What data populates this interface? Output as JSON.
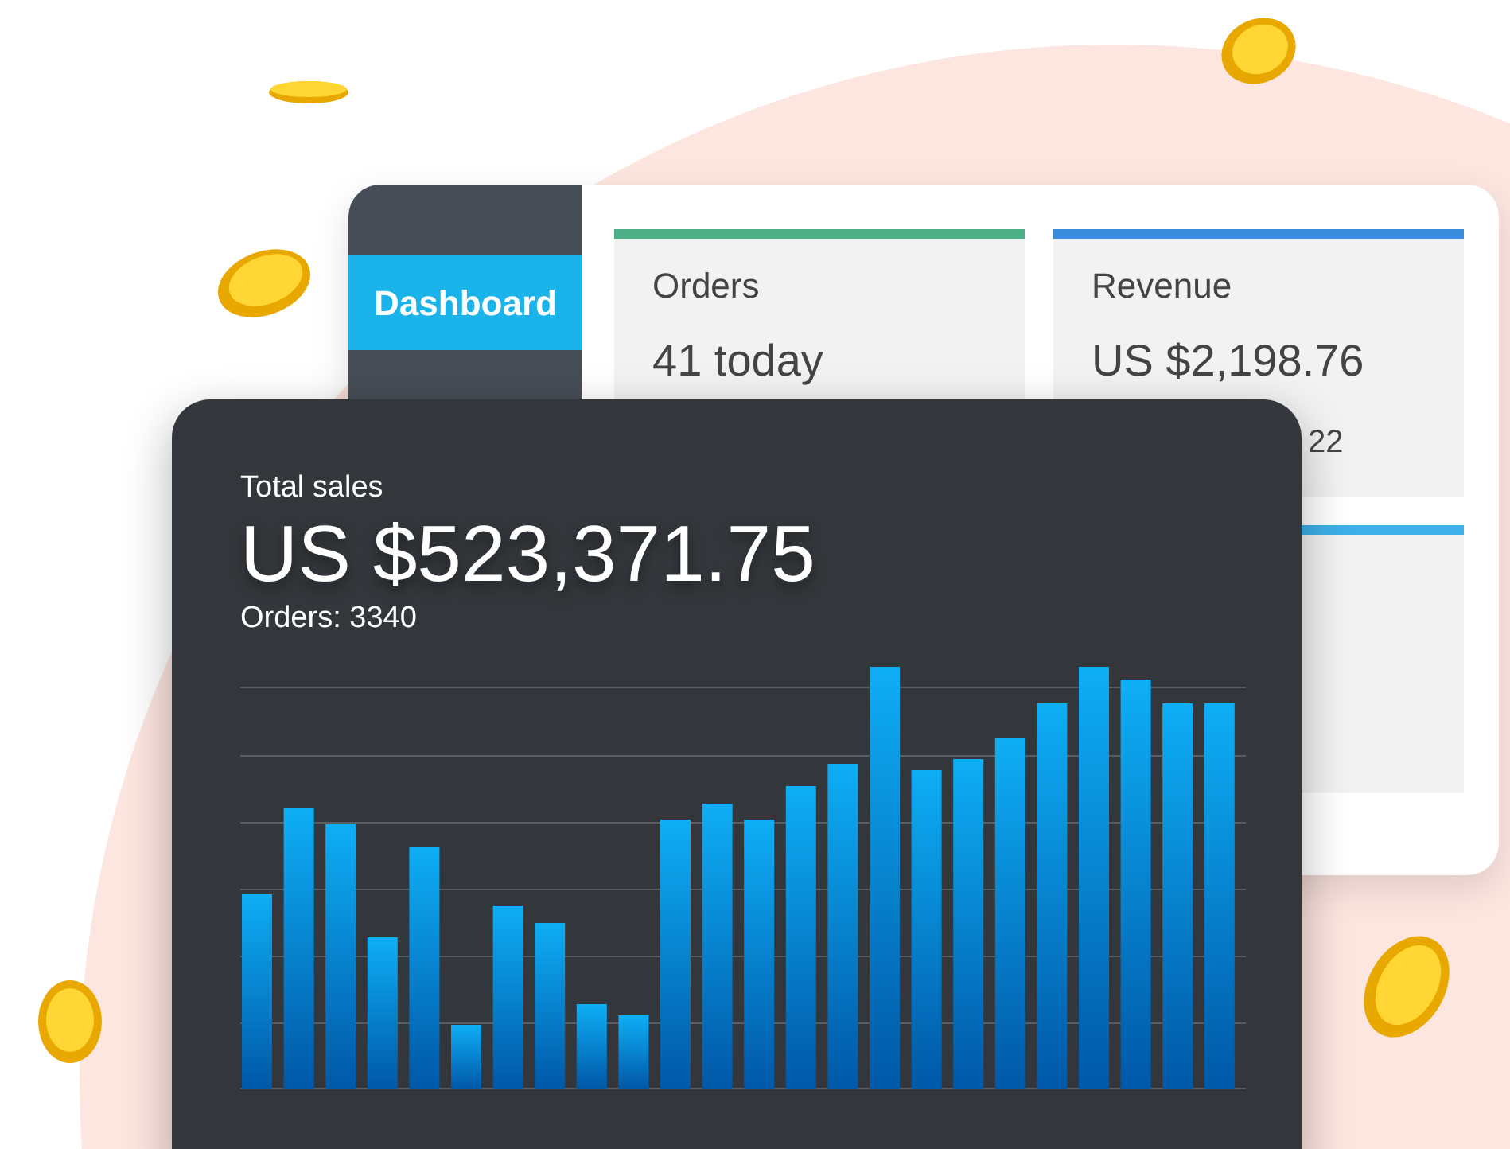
{
  "sidebar": {
    "items": [
      {
        "label": "Dashboard",
        "selected": true
      }
    ]
  },
  "stat_cards": [
    {
      "title": "Orders",
      "value": "41 today",
      "color": "#4caf87"
    },
    {
      "title": "Revenue",
      "value": "US $2,198.76",
      "detail": "22",
      "color": "#3a8ddc"
    },
    {
      "color": "#3db0e8"
    }
  ],
  "sales_card": {
    "title": "Total sales",
    "amount": "US $523,371.75",
    "orders": "Orders: 3340"
  }
}
